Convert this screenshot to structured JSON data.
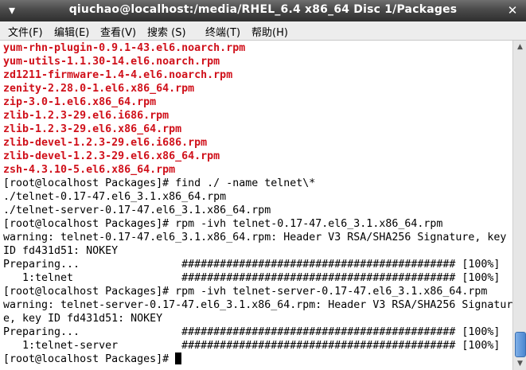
{
  "window": {
    "title": "qiuchao@localhost:/media/RHEL_6.4 x86_64 Disc 1/Packages",
    "minimize_glyph": "▾",
    "close_glyph": "✕"
  },
  "menu": [
    {
      "label": "文件(F)"
    },
    {
      "label": "编辑(E)"
    },
    {
      "label": "查看(V)"
    },
    {
      "label": "搜索 (S)"
    },
    {
      "label": "终端(T)"
    },
    {
      "label": "帮助(H)"
    }
  ],
  "terminal": {
    "lines": [
      {
        "text": "yum-rhn-plugin-0.9.1-43.el6.noarch.rpm",
        "style": "red"
      },
      {
        "text": "yum-utils-1.1.30-14.el6.noarch.rpm",
        "style": "red"
      },
      {
        "text": "zd1211-firmware-1.4-4.el6.noarch.rpm",
        "style": "red"
      },
      {
        "text": "zenity-2.28.0-1.el6.x86_64.rpm",
        "style": "red"
      },
      {
        "text": "zip-3.0-1.el6.x86_64.rpm",
        "style": "red"
      },
      {
        "text": "zlib-1.2.3-29.el6.i686.rpm",
        "style": "red"
      },
      {
        "text": "zlib-1.2.3-29.el6.x86_64.rpm",
        "style": "red"
      },
      {
        "text": "zlib-devel-1.2.3-29.el6.i686.rpm",
        "style": "red"
      },
      {
        "text": "zlib-devel-1.2.3-29.el6.x86_64.rpm",
        "style": "red"
      },
      {
        "text": "zsh-4.3.10-5.el6.x86_64.rpm",
        "style": "red"
      },
      {
        "text": "[root@localhost Packages]# find ./ -name telnet\\*",
        "style": "normal"
      },
      {
        "text": "./telnet-0.17-47.el6_3.1.x86_64.rpm",
        "style": "normal"
      },
      {
        "text": "./telnet-server-0.17-47.el6_3.1.x86_64.rpm",
        "style": "normal"
      },
      {
        "text": "[root@localhost Packages]# rpm -ivh telnet-0.17-47.el6_3.1.x86_64.rpm",
        "style": "normal"
      },
      {
        "text": "warning: telnet-0.17-47.el6_3.1.x86_64.rpm: Header V3 RSA/SHA256 Signature, key",
        "style": "normal"
      },
      {
        "text": "ID fd431d51: NOKEY",
        "style": "normal"
      },
      {
        "text": "Preparing...                ########################################### [100%]",
        "style": "normal"
      },
      {
        "text": "   1:telnet                 ########################################### [100%]",
        "style": "normal"
      },
      {
        "text": "[root@localhost Packages]# rpm -ivh telnet-server-0.17-47.el6_3.1.x86_64.rpm",
        "style": "normal"
      },
      {
        "text": "warning: telnet-server-0.17-47.el6_3.1.x86_64.rpm: Header V3 RSA/SHA256 Signatur",
        "style": "normal"
      },
      {
        "text": "e, key ID fd431d51: NOKEY",
        "style": "normal"
      },
      {
        "text": "Preparing...                ########################################### [100%]",
        "style": "normal"
      },
      {
        "text": "   1:telnet-server          ########################################### [100%]",
        "style": "normal"
      }
    ],
    "prompt": "[root@localhost Packages]# "
  },
  "scrollbar": {
    "up_glyph": "▲",
    "down_glyph": "▼",
    "position": "bottom"
  }
}
